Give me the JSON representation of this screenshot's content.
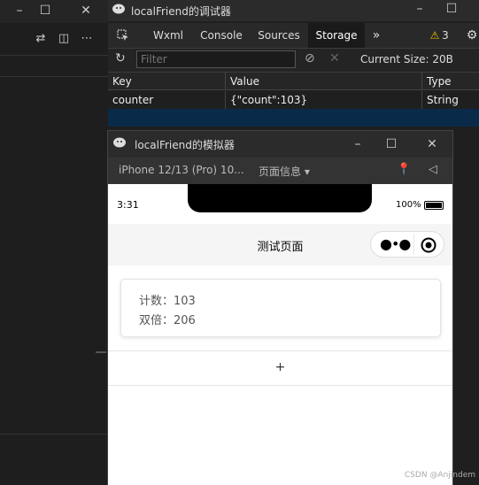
{
  "devtools": {
    "title": "localFriend的调试器",
    "tabs": [
      "Wxml",
      "Console",
      "Sources",
      "Storage"
    ],
    "active_tab": "Storage",
    "more_tabs_glyph": "»",
    "warning_count": "3",
    "filter_placeholder": "Filter",
    "current_size_label": "Current Size: 20B",
    "table": {
      "columns": [
        "Key",
        "Value",
        "Type"
      ],
      "rows": [
        {
          "key": "counter",
          "value": "{\"count\":103}",
          "type": "String"
        }
      ]
    }
  },
  "simulator": {
    "title": "localFriend的模拟器",
    "device": "iPhone 12/13 (Pro) 10...",
    "page_info": "页面信息 ▾",
    "status": {
      "time": "3:31",
      "battery": "100%",
      "battery_level": 1.0
    },
    "nav_title": "测试页面",
    "card": {
      "count_line": "计数：103",
      "double_line": "双倍：206"
    },
    "plus_label": "+"
  },
  "watermark": "CSDN @Anjindem",
  "colors": {
    "warning": "#f0c000",
    "pin": "#e04040",
    "selected_row": "#0a2a4a"
  }
}
